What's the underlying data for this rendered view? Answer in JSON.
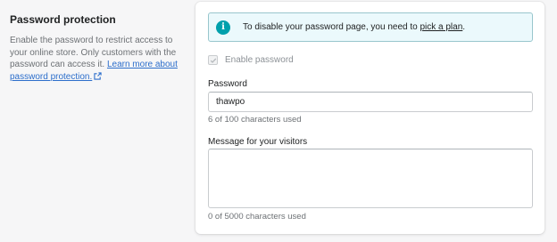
{
  "section": {
    "title": "Password protection",
    "description": "Enable the password to restrict access to your online store. Only customers with the password can access it.",
    "learn_more_link": "Learn more about password protection."
  },
  "banner": {
    "text": "To disable your password page, you need to",
    "link": "pick a plan",
    "suffix": "."
  },
  "enable_password": {
    "label": "Enable password",
    "checked": true,
    "disabled": true
  },
  "password_field": {
    "label": "Password",
    "value": "thawpo",
    "help": "6 of 100 characters used"
  },
  "message_field": {
    "label": "Message for your visitors",
    "value": "",
    "help": "0 of 5000 characters used"
  },
  "colors": {
    "banner_bg": "#ebf9fc",
    "banner_border": "#98c6cd",
    "info_icon": "#00a0ac",
    "link": "#2c6ecb"
  }
}
